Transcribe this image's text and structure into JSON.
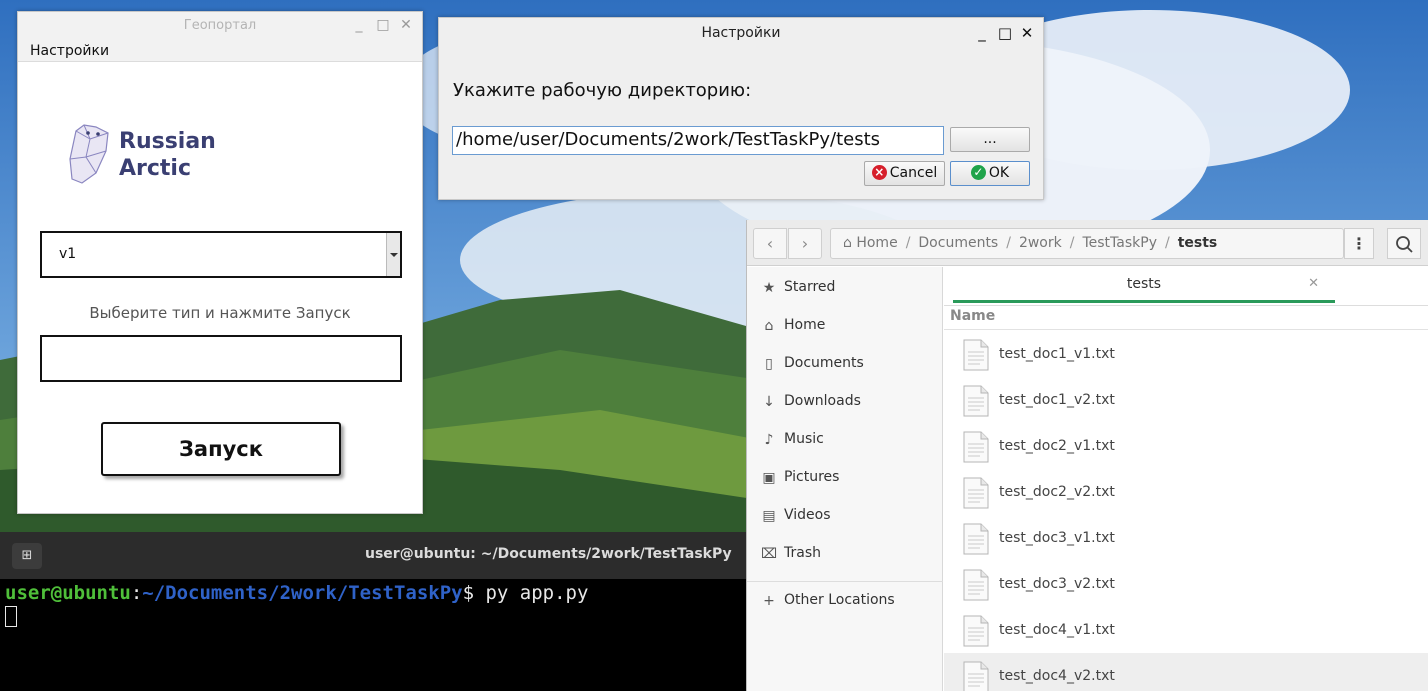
{
  "geoportal": {
    "title": "Геопортал",
    "menu": "Настройки",
    "logo_line1": "Russian",
    "logo_line2": "Arctic",
    "combo_value": "v1",
    "hint": "Выберите тип и нажмите Запуск",
    "launch_label": "Запуск"
  },
  "settings": {
    "title": "Настройки",
    "prompt": "Укажите рабочую директорию:",
    "path_value": "/home/user/Documents/2work/TestTaskPy/tests",
    "browse_label": "...",
    "cancel_label": "Cancel",
    "ok_label": "OK"
  },
  "terminal": {
    "title": "user@ubuntu: ~/Documents/2work/TestTaskPy",
    "prompt_user": "user@ubuntu",
    "prompt_colon": ":",
    "prompt_path": "~/Documents/2work/TestTaskPy",
    "command": "$ py app.py"
  },
  "files": {
    "breadcrumbs": [
      "Home",
      "Documents",
      "2work",
      "TestTaskPy",
      "tests"
    ],
    "sidebar": [
      {
        "label": "Starred",
        "icon": "star-icon"
      },
      {
        "label": "Home",
        "icon": "home-icon"
      },
      {
        "label": "Documents",
        "icon": "documents-icon"
      },
      {
        "label": "Downloads",
        "icon": "downloads-icon"
      },
      {
        "label": "Music",
        "icon": "music-icon"
      },
      {
        "label": "Pictures",
        "icon": "pictures-icon"
      },
      {
        "label": "Videos",
        "icon": "videos-icon"
      },
      {
        "label": "Trash",
        "icon": "trash-icon"
      }
    ],
    "other_locations": "Other Locations",
    "tab_label": "tests",
    "column_name": "Name",
    "file_list": [
      "test_doc1_v1.txt",
      "test_doc1_v2.txt",
      "test_doc2_v1.txt",
      "test_doc2_v2.txt",
      "test_doc3_v1.txt",
      "test_doc3_v2.txt",
      "test_doc4_v1.txt",
      "test_doc4_v2.txt"
    ]
  },
  "colors": {
    "accent_green": "#2a9a5a",
    "terminal_user": "#4fbf3a",
    "terminal_path": "#2f62c8"
  }
}
